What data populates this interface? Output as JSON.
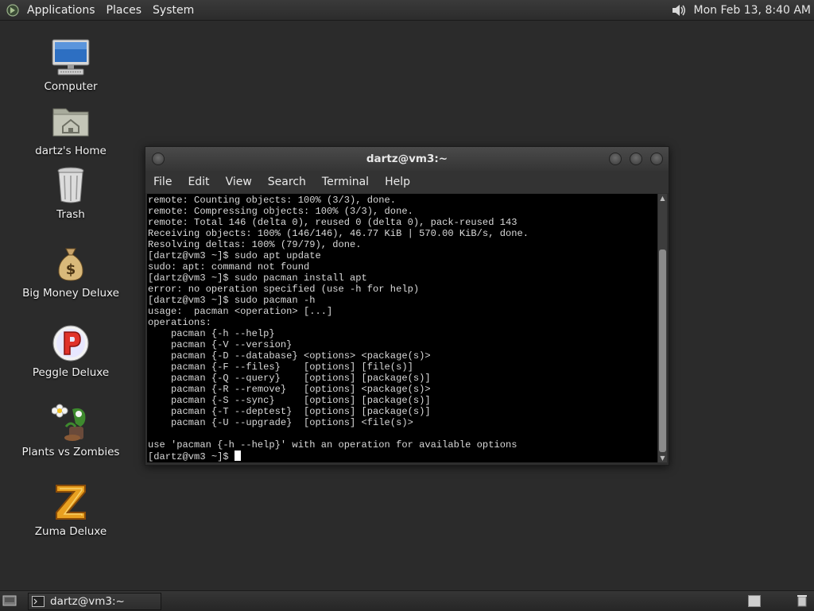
{
  "top_panel": {
    "menus": [
      "Applications",
      "Places",
      "System"
    ],
    "clock": "Mon Feb 13,  8:40 AM"
  },
  "desktop_icons": [
    {
      "label": "Computer",
      "icon": "computer-icon"
    },
    {
      "label": "dartz's Home",
      "icon": "home-folder-icon"
    },
    {
      "label": "Trash",
      "icon": "trash-icon"
    },
    {
      "label": "Big Money Deluxe",
      "icon": "money-bag-icon"
    },
    {
      "label": "Peggle Deluxe",
      "icon": "peggle-icon"
    },
    {
      "label": "Plants vs Zombies",
      "icon": "plants-vs-zombies-icon"
    },
    {
      "label": "Zuma Deluxe",
      "icon": "zuma-icon"
    }
  ],
  "terminal": {
    "title": "dartz@vm3:~",
    "menu": [
      "File",
      "Edit",
      "View",
      "Search",
      "Terminal",
      "Help"
    ],
    "output": "remote: Counting objects: 100% (3/3), done.\nremote: Compressing objects: 100% (3/3), done.\nremote: Total 146 (delta 0), reused 0 (delta 0), pack-reused 143\nReceiving objects: 100% (146/146), 46.77 KiB | 570.00 KiB/s, done.\nResolving deltas: 100% (79/79), done.\n[dartz@vm3 ~]$ sudo apt update\nsudo: apt: command not found\n[dartz@vm3 ~]$ sudo pacman install apt\nerror: no operation specified (use -h for help)\n[dartz@vm3 ~]$ sudo pacman -h\nusage:  pacman <operation> [...]\noperations:\n    pacman {-h --help}\n    pacman {-V --version}\n    pacman {-D --database} <options> <package(s)>\n    pacman {-F --files}    [options] [file(s)]\n    pacman {-Q --query}    [options] [package(s)]\n    pacman {-R --remove}   [options] <package(s)>\n    pacman {-S --sync}     [options] [package(s)]\n    pacman {-T --deptest}  [options] [package(s)]\n    pacman {-U --upgrade}  [options] <file(s)>\n\nuse 'pacman {-h --help}' with an operation for available options\n",
    "prompt": "[dartz@vm3 ~]$ "
  },
  "taskbar": {
    "items": [
      {
        "label": "dartz@vm3:~",
        "icon": "terminal-icon"
      }
    ]
  },
  "colors": {
    "desktop_bg": "#2b2b2b",
    "terminal_bg": "#000000",
    "terminal_fg": "#d9d9d9"
  }
}
